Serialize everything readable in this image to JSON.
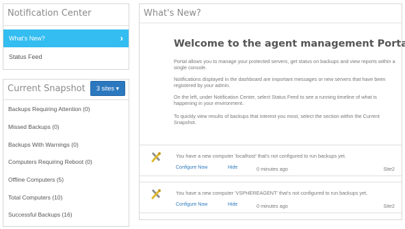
{
  "notification_center": {
    "title": "Notification Center",
    "items": [
      {
        "label": "What's New?",
        "active": true
      },
      {
        "label": "Status Feed",
        "active": false
      }
    ]
  },
  "current_snapshot": {
    "title": "Current Snapshot",
    "sites_button": "3 sites ▾",
    "items": [
      {
        "label": "Backups Requiring Attention (0)"
      },
      {
        "label": "Missed Backups (0)"
      },
      {
        "label": "Backups With Warnings (0)"
      },
      {
        "label": "Computers Requiring Reboot (0)"
      },
      {
        "label": "Offline Computers (5)"
      },
      {
        "label": "Total Computers (10)"
      },
      {
        "label": "Successful Backups (16)"
      }
    ]
  },
  "whats_new": {
    "title": "What's New?",
    "welcome_title": "Welcome to the agent management Portal!",
    "paragraphs": [
      "Portal allows you to manage your protected servers, get status on backups and view reports within a single console.",
      "Notifications displayed in the dashboard are important messages or new servers that have been registered by your admin.",
      "On the left, under Notification Center, select Status Feed to see a running timeline of what is happening in your environment.",
      "To quickly view results of backups that interest you most, select the section within the Current Snapshot."
    ],
    "notifications": [
      {
        "message": "You have a new computer 'localhost' that's not configured to run backups yet.",
        "configure_label": "Configure Now",
        "hide_label": "Hide",
        "time": "0 minutes ago",
        "site": "Site2",
        "icon": "tools-icon"
      },
      {
        "message": "You have a new computer 'VSPHEREAGENT' that's not configured to run backups yet.",
        "configure_label": "Configure Now",
        "hide_label": "Hide",
        "time": "0 minutes ago",
        "site": "Site2",
        "icon": "tools-icon"
      }
    ]
  },
  "colors": {
    "accent": "#33bdf0",
    "button": "#2c78bf",
    "link": "#2c78bf",
    "text": "#555555"
  }
}
